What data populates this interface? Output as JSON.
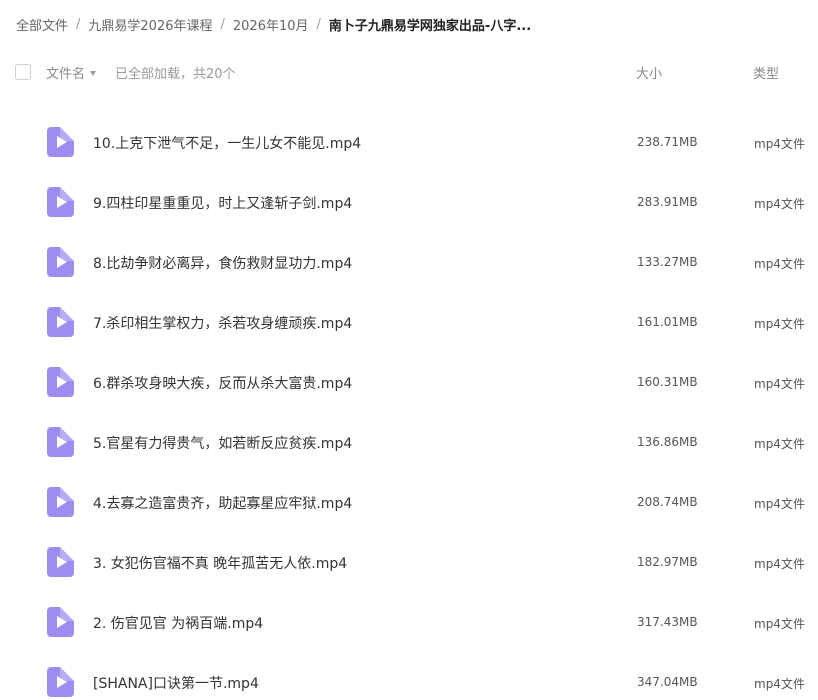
{
  "breadcrumb": {
    "items": [
      "全部文件",
      "九鼎易学2026年课程",
      "2026年10月",
      "南卜子九鼎易学网独家出品-八字..."
    ],
    "separator": "/"
  },
  "header": {
    "name_label": "文件名",
    "load_status": "已全部加载，共20个",
    "size_label": "大小",
    "type_label": "类型"
  },
  "files": [
    {
      "name": "10.上克下泄气不足，一生儿女不能见.mp4",
      "size": "238.71MB",
      "type": "mp4文件"
    },
    {
      "name": "9.四柱印星重重见，时上又逢斩子剑.mp4",
      "size": "283.91MB",
      "type": "mp4文件"
    },
    {
      "name": "8.比劫争财必离异，食伤救财显功力.mp4",
      "size": "133.27MB",
      "type": "mp4文件"
    },
    {
      "name": "7.杀印相生掌权力，杀若攻身缠顽疾.mp4",
      "size": "161.01MB",
      "type": "mp4文件"
    },
    {
      "name": "6.群杀攻身映大疾，反而从杀大富贵.mp4",
      "size": "160.31MB",
      "type": "mp4文件"
    },
    {
      "name": "5.官星有力得贵气，如若断反应贫疾.mp4",
      "size": "136.86MB",
      "type": "mp4文件"
    },
    {
      "name": "4.去寡之造富贵齐，助起寡星应牢狱.mp4",
      "size": "208.74MB",
      "type": "mp4文件"
    },
    {
      "name": "3. 女犯伤官福不真 晚年孤苦无人依.mp4",
      "size": "182.97MB",
      "type": "mp4文件"
    },
    {
      "name": "2. 伤官见官 为祸百端.mp4",
      "size": "317.43MB",
      "type": "mp4文件"
    },
    {
      "name": "[SHANA]口诀第一节.mp4",
      "size": "347.04MB",
      "type": "mp4文件"
    }
  ],
  "icons": {
    "file_icon": "video-file-icon",
    "sort": "sort-down-icon"
  },
  "colors": {
    "video_icon": "#9d8df1",
    "text_primary": "#333333",
    "text_muted": "#888888"
  }
}
